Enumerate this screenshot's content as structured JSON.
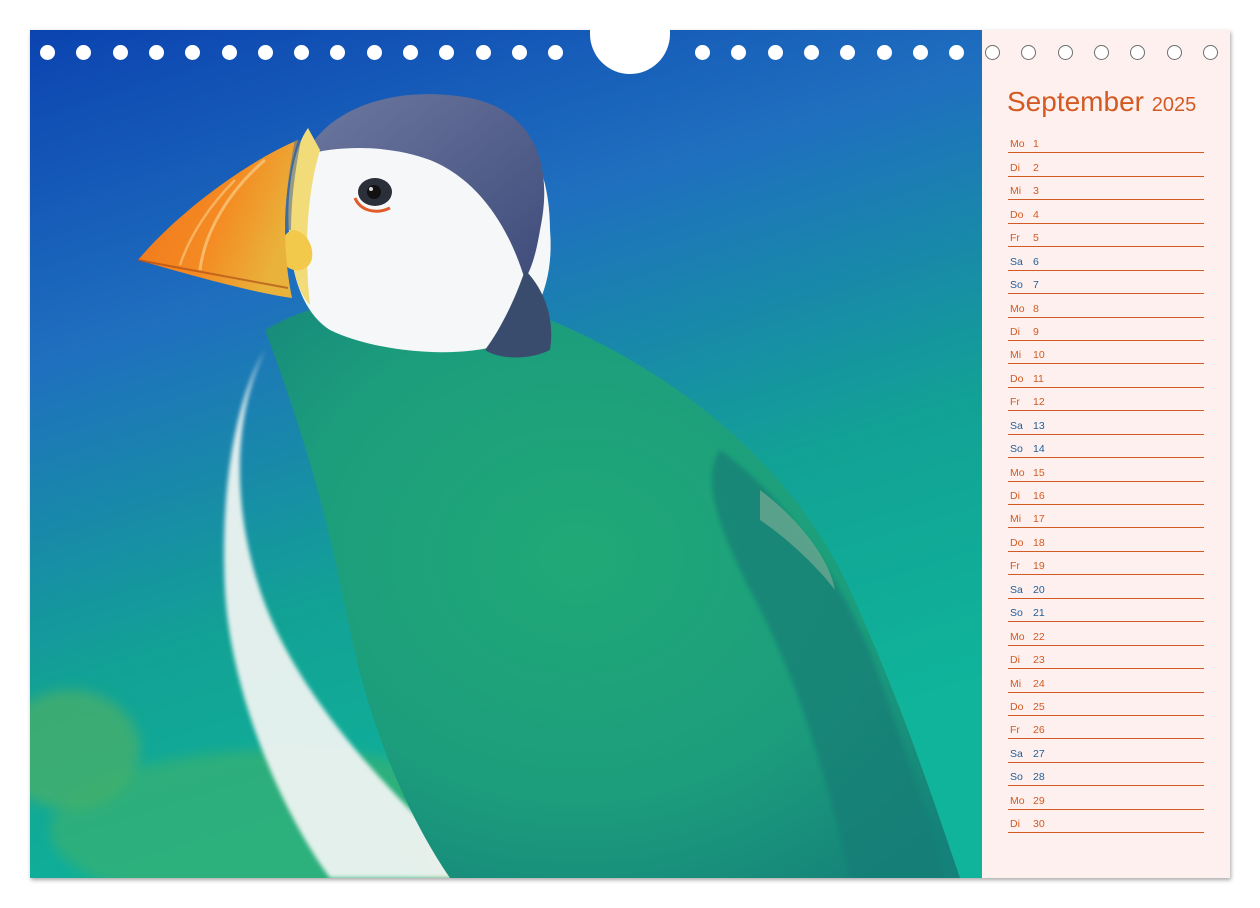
{
  "calendar": {
    "month": "September",
    "year": "2025",
    "days": [
      {
        "wd": "Mo",
        "num": "1",
        "weekend": false
      },
      {
        "wd": "Di",
        "num": "2",
        "weekend": false
      },
      {
        "wd": "Mi",
        "num": "3",
        "weekend": false
      },
      {
        "wd": "Do",
        "num": "4",
        "weekend": false
      },
      {
        "wd": "Fr",
        "num": "5",
        "weekend": false
      },
      {
        "wd": "Sa",
        "num": "6",
        "weekend": true
      },
      {
        "wd": "So",
        "num": "7",
        "weekend": true
      },
      {
        "wd": "Mo",
        "num": "8",
        "weekend": false
      },
      {
        "wd": "Di",
        "num": "9",
        "weekend": false
      },
      {
        "wd": "Mi",
        "num": "10",
        "weekend": false
      },
      {
        "wd": "Do",
        "num": "11",
        "weekend": false
      },
      {
        "wd": "Fr",
        "num": "12",
        "weekend": false
      },
      {
        "wd": "Sa",
        "num": "13",
        "weekend": true
      },
      {
        "wd": "So",
        "num": "14",
        "weekend": true
      },
      {
        "wd": "Mo",
        "num": "15",
        "weekend": false
      },
      {
        "wd": "Di",
        "num": "16",
        "weekend": false
      },
      {
        "wd": "Mi",
        "num": "17",
        "weekend": false
      },
      {
        "wd": "Do",
        "num": "18",
        "weekend": false
      },
      {
        "wd": "Fr",
        "num": "19",
        "weekend": false
      },
      {
        "wd": "Sa",
        "num": "20",
        "weekend": true
      },
      {
        "wd": "So",
        "num": "21",
        "weekend": true
      },
      {
        "wd": "Mo",
        "num": "22",
        "weekend": false
      },
      {
        "wd": "Di",
        "num": "23",
        "weekend": false
      },
      {
        "wd": "Mi",
        "num": "24",
        "weekend": false
      },
      {
        "wd": "Do",
        "num": "25",
        "weekend": false
      },
      {
        "wd": "Fr",
        "num": "26",
        "weekend": false
      },
      {
        "wd": "Sa",
        "num": "27",
        "weekend": true
      },
      {
        "wd": "So",
        "num": "28",
        "weekend": true
      },
      {
        "wd": "Mo",
        "num": "29",
        "weekend": false
      },
      {
        "wd": "Di",
        "num": "30",
        "weekend": false
      }
    ]
  },
  "colors": {
    "accent": "#d35a22",
    "weekend": "#1f5e99",
    "rule": "#d35a22",
    "sidebar_bg": "#fdf0ee",
    "photo_top": "#0d4fb5",
    "photo_bottom": "#0aa58e"
  },
  "photo": {
    "subject": "puffin-photo"
  }
}
